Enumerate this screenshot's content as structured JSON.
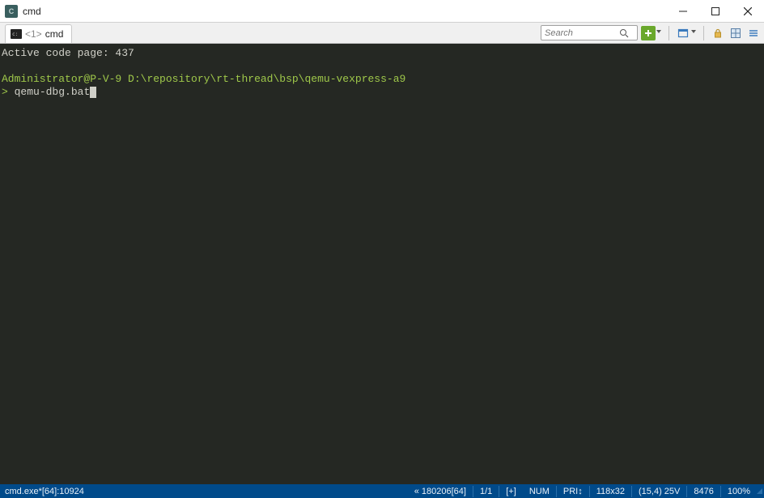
{
  "titlebar": {
    "title": "cmd"
  },
  "tabbar": {
    "tab": {
      "index": "<1>",
      "label": "cmd"
    },
    "search_placeholder": "Search"
  },
  "terminal": {
    "codepage_line": "Active code page: 437",
    "user_host": "Administrator@P-V-9",
    "cwd": "D:\\repository\\rt-thread\\bsp\\qemu-vexpress-a9",
    "prompt": ">",
    "command": "qemu-dbg.bat"
  },
  "statusbar": {
    "process": "cmd.exe*[64]:10924",
    "left_arrow": "«",
    "segment1": "180206[64]",
    "segment2": "1/1",
    "segment3": "[+]",
    "num": "NUM",
    "pri": "PRI",
    "pri_arrow": "↕",
    "dims": "118x32",
    "cursor_pos": "(15,4) 25V",
    "mem": "8476",
    "zoom": "100%"
  }
}
